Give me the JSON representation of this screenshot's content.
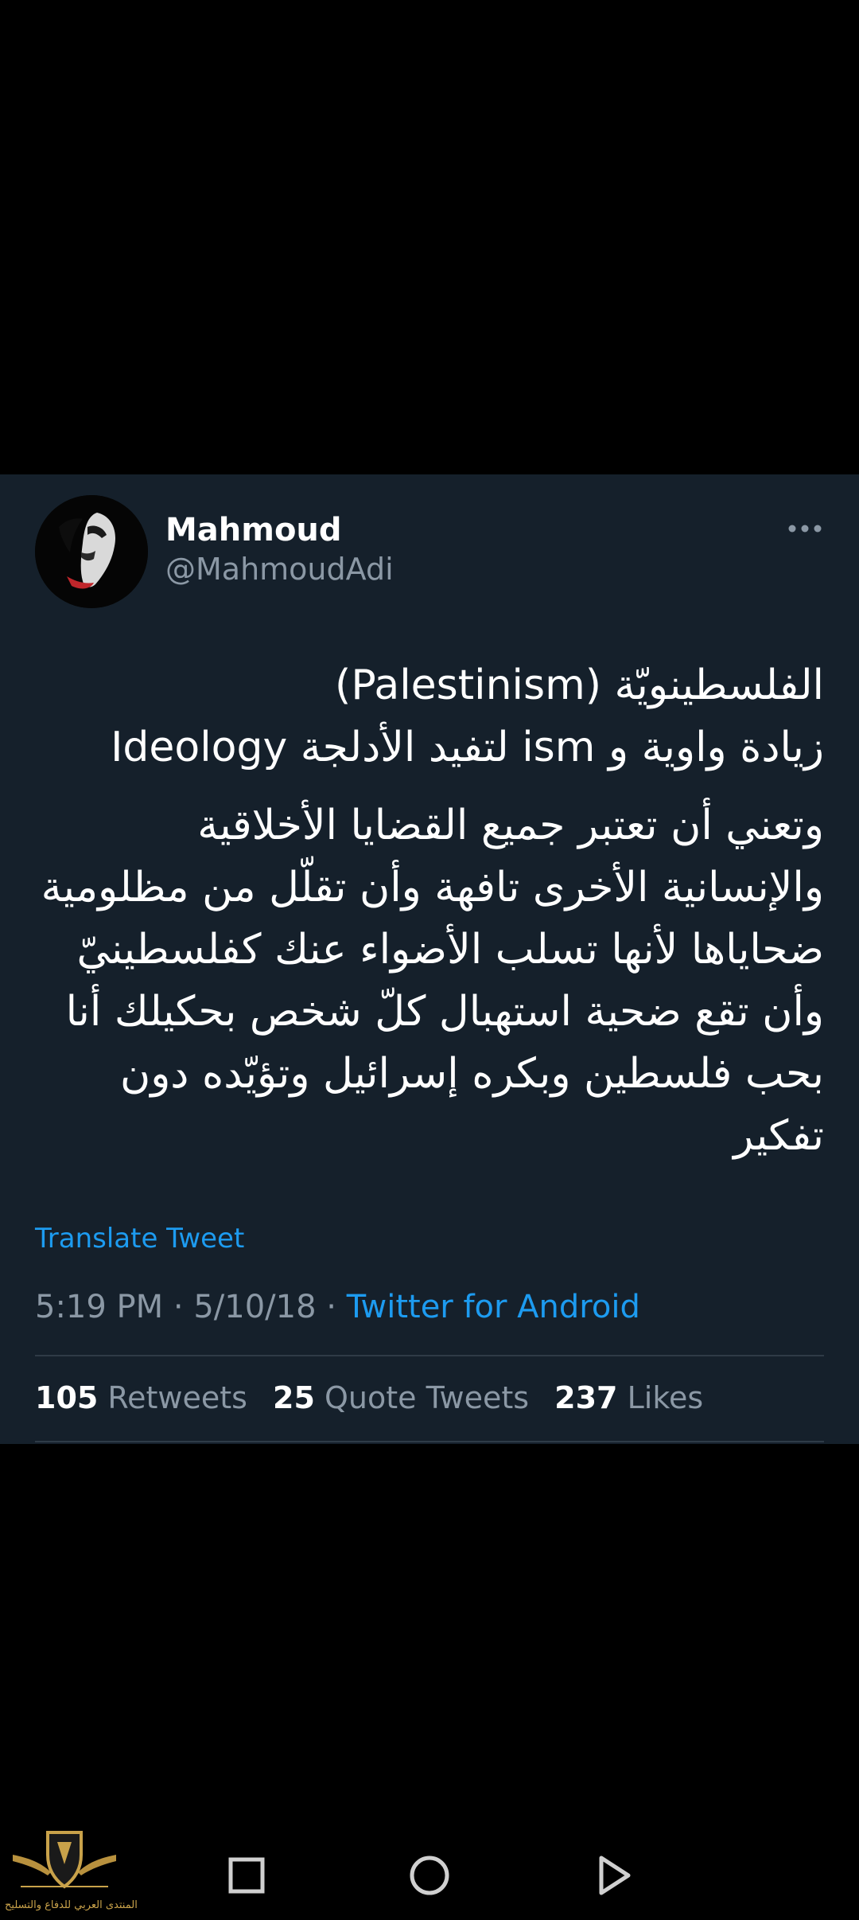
{
  "tweet": {
    "display_name": "Mahmoud",
    "handle": "@MahmoudAdi",
    "text_lines_1": [
      "الفلسطينويّة (Palestinism)",
      "زيادة واوية و ism لتفيد الأدلجة Ideology"
    ],
    "text_lines_2": [
      "وتعني أن تعتبر جميع القضايا الأخلاقية",
      "والإنسانية الأخرى تافهة وأن تقلّل من مظلومية",
      "ضحاياها لأنها تسلب الأضواء عنك كفلسطينيّ",
      "وأن تقع ضحية استهبال كلّ شخص بحكيلك أنا",
      "بحب فلسطين وبكره إسرائيل وتؤيّده دون",
      "تفكير"
    ],
    "translate_label": "Translate Tweet",
    "time": "5:19 PM",
    "date": "5/10/18",
    "separator": "·",
    "source": "Twitter for Android",
    "stats": [
      {
        "count": "105",
        "label": "Retweets"
      },
      {
        "count": "25",
        "label": "Quote Tweets"
      },
      {
        "count": "237",
        "label": "Likes"
      }
    ]
  },
  "icons": {
    "more": "more-horizontal-icon",
    "nav_back": "square-icon",
    "nav_home": "circle-icon",
    "nav_recents": "triangle-icon"
  },
  "watermark": {
    "text": "المنتدى العربي للدفاع والتسليح"
  },
  "colors": {
    "background": "#000000",
    "card": "#15202b",
    "text_primary": "#ffffff",
    "text_secondary": "#8b98a5",
    "accent": "#1d9bf0",
    "divider": "#2f3b47"
  }
}
